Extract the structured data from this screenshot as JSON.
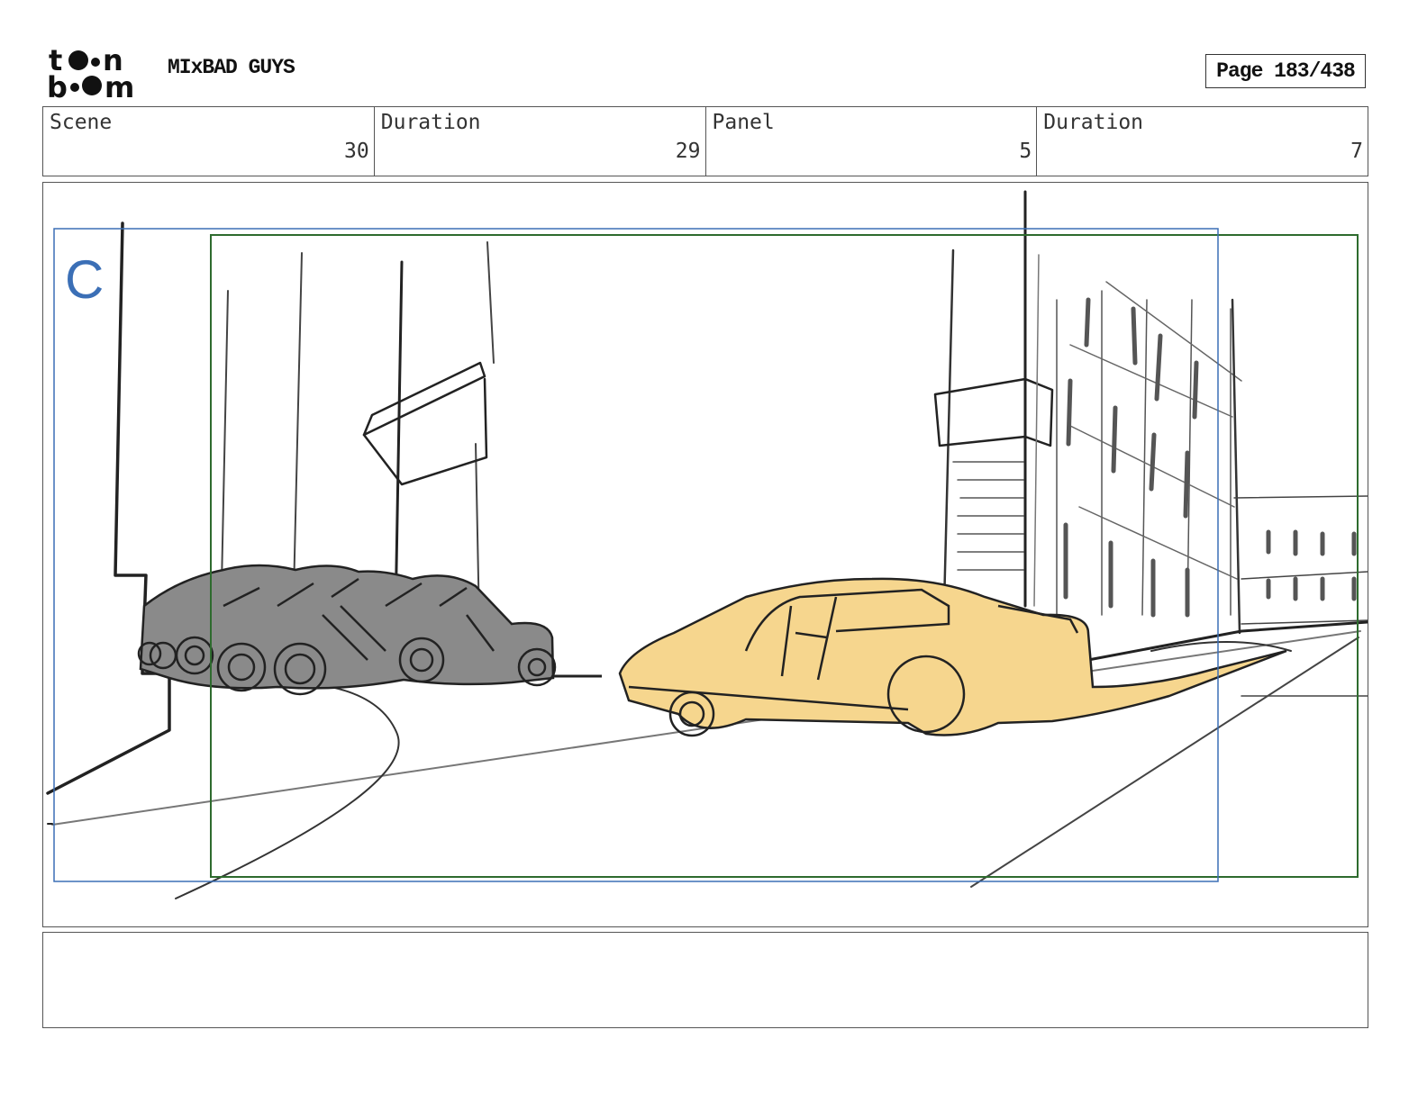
{
  "header": {
    "logo_text_top": "toon",
    "logo_text_bottom": "boom",
    "show_title": "MIxBAD GUYS",
    "page_label": "Page 183/438"
  },
  "info": {
    "scene_label": "Scene",
    "scene_value": "30",
    "scene_duration_label": "Duration",
    "scene_duration_value": "29",
    "panel_label": "Panel",
    "panel_value": "5",
    "panel_duration_label": "Duration",
    "panel_duration_value": "7"
  },
  "panel": {
    "camera_label": "C",
    "camera_frame_color": "#3b6fb6",
    "safe_frame_color": "#2e6b2e",
    "car_fill_color": "#f6d68e",
    "vehicles_fill_color": "#8a8a8a"
  },
  "caption": {
    "dialogue": ""
  }
}
